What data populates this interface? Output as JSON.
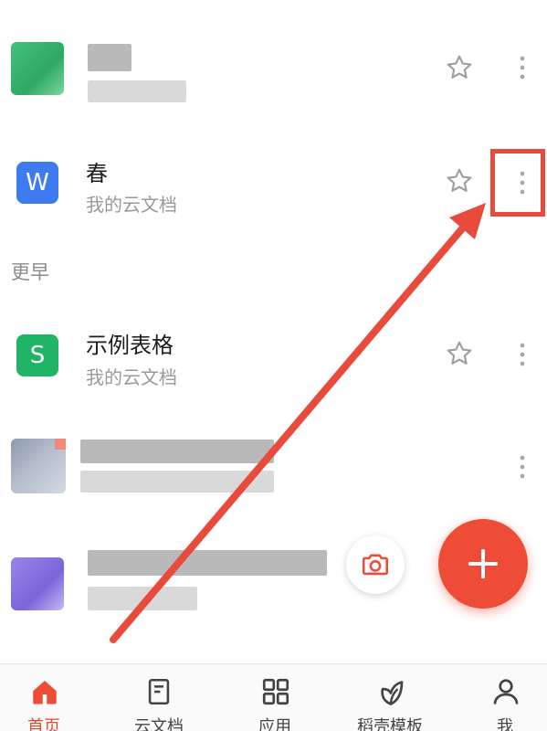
{
  "files": [
    {
      "title": "",
      "subtitle": "",
      "icon": "spreadsheet-thumbnail-blurred",
      "starred": false
    },
    {
      "title": "春",
      "subtitle": "我的云文档",
      "icon": "word-doc-icon",
      "icon_letter": "W",
      "starred": false
    },
    {
      "title": "示例表格",
      "subtitle": "我的云文档",
      "icon": "spreadsheet-icon",
      "icon_letter": "S",
      "starred": false
    },
    {
      "title": "",
      "subtitle": "",
      "icon": "image-thumbnail-blurred"
    },
    {
      "title": "",
      "subtitle": "",
      "icon": "document-thumbnail-blurred"
    }
  ],
  "section": {
    "earlier_label": "更早"
  },
  "nav": {
    "items": [
      {
        "label": "首页",
        "icon": "home-icon",
        "active": true
      },
      {
        "label": "云文档",
        "icon": "document-icon",
        "active": false
      },
      {
        "label": "应用",
        "icon": "apps-grid-icon",
        "active": false
      },
      {
        "label": "稻壳模板",
        "icon": "leaf-icon",
        "active": false
      },
      {
        "label": "我",
        "icon": "person-icon",
        "active": false
      }
    ]
  },
  "colors": {
    "accent": "#ee4c36",
    "annotation": "#e84a3c",
    "word_blue": "#3e7bf0",
    "sheet_green": "#1fb466"
  }
}
